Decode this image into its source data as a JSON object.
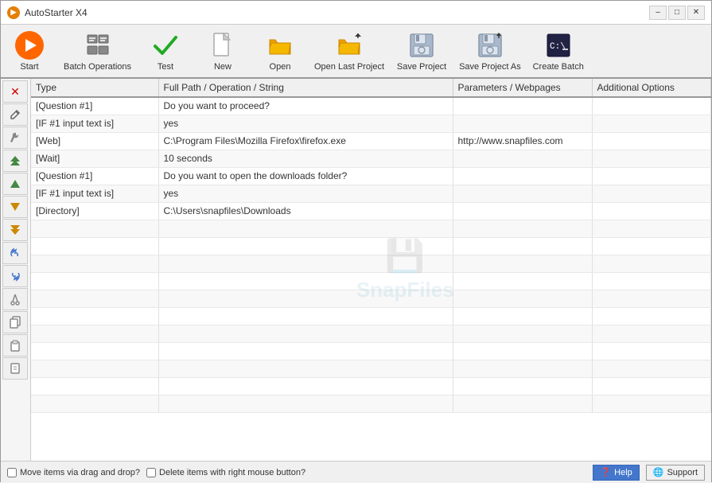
{
  "titleBar": {
    "appName": "AutoStarter X4",
    "minimizeLabel": "–",
    "maximizeLabel": "□",
    "closeLabel": "✕"
  },
  "toolbar": {
    "buttons": [
      {
        "id": "start",
        "label": "Start",
        "iconType": "start"
      },
      {
        "id": "batch-operations",
        "label": "Batch Operations",
        "iconType": "batch"
      },
      {
        "id": "test",
        "label": "Test",
        "iconType": "check"
      },
      {
        "id": "new",
        "label": "New",
        "iconType": "new"
      },
      {
        "id": "open",
        "label": "Open",
        "iconType": "folder"
      },
      {
        "id": "open-last-project",
        "label": "Open Last Project",
        "iconType": "folder-open"
      },
      {
        "id": "save-project",
        "label": "Save Project",
        "iconType": "save"
      },
      {
        "id": "save-project-as",
        "label": "Save Project As",
        "iconType": "save-as"
      },
      {
        "id": "create-batch",
        "label": "Create Batch",
        "iconType": "batch-create"
      }
    ]
  },
  "sideToolbar": {
    "buttons": [
      {
        "id": "delete",
        "icon": "✕",
        "tooltip": "Delete",
        "color": "red"
      },
      {
        "id": "tool2",
        "icon": "🔧",
        "tooltip": "Edit"
      },
      {
        "id": "tool3",
        "icon": "✏️",
        "tooltip": "Rename"
      },
      {
        "id": "move-up-fast",
        "icon": "⬆",
        "tooltip": "Move Up Fast"
      },
      {
        "id": "move-up",
        "icon": "↑",
        "tooltip": "Move Up"
      },
      {
        "id": "move-down",
        "icon": "↓",
        "tooltip": "Move Down"
      },
      {
        "id": "move-down-fast",
        "icon": "⬇",
        "tooltip": "Move Down Fast"
      },
      {
        "id": "rotate-up",
        "icon": "↩",
        "tooltip": "Rotate Up"
      },
      {
        "id": "rotate-down",
        "icon": "↪",
        "tooltip": "Rotate Down"
      },
      {
        "id": "cut",
        "icon": "✂",
        "tooltip": "Cut"
      },
      {
        "id": "copy",
        "icon": "⧉",
        "tooltip": "Copy"
      },
      {
        "id": "paste",
        "icon": "📋",
        "tooltip": "Paste"
      },
      {
        "id": "paste2",
        "icon": "📄",
        "tooltip": "Paste Special"
      }
    ]
  },
  "table": {
    "columns": [
      {
        "id": "type",
        "label": "Type"
      },
      {
        "id": "path",
        "label": "Full Path / Operation / String"
      },
      {
        "id": "params",
        "label": "Parameters / Webpages"
      },
      {
        "id": "options",
        "label": "Additional Options"
      }
    ],
    "rows": [
      {
        "type": "[Question #1]",
        "path": "Do you want to proceed?",
        "params": "",
        "options": ""
      },
      {
        "type": "[IF #1 input text is]",
        "path": "yes",
        "params": "",
        "options": ""
      },
      {
        "type": "[Web]",
        "path": "C:\\Program Files\\Mozilla Firefox\\firefox.exe",
        "params": "http://www.snapfiles.com",
        "options": ""
      },
      {
        "type": "[Wait]",
        "path": "10 seconds",
        "params": "",
        "options": ""
      },
      {
        "type": "[Question #1]",
        "path": "Do you want to open the downloads folder?",
        "params": "",
        "options": ""
      },
      {
        "type": "[IF #1 input text is]",
        "path": "yes",
        "params": "",
        "options": ""
      },
      {
        "type": "[Directory]",
        "path": "C:\\Users\\snapfiles\\Downloads",
        "params": "",
        "options": ""
      },
      {
        "type": "",
        "path": "",
        "params": "",
        "options": ""
      },
      {
        "type": "",
        "path": "",
        "params": "",
        "options": ""
      },
      {
        "type": "",
        "path": "",
        "params": "",
        "options": ""
      },
      {
        "type": "",
        "path": "",
        "params": "",
        "options": ""
      },
      {
        "type": "",
        "path": "",
        "params": "",
        "options": ""
      },
      {
        "type": "",
        "path": "",
        "params": "",
        "options": ""
      },
      {
        "type": "",
        "path": "",
        "params": "",
        "options": ""
      },
      {
        "type": "",
        "path": "",
        "params": "",
        "options": ""
      },
      {
        "type": "",
        "path": "",
        "params": "",
        "options": ""
      },
      {
        "type": "",
        "path": "",
        "params": "",
        "options": ""
      },
      {
        "type": "",
        "path": "",
        "params": "",
        "options": ""
      }
    ]
  },
  "watermark": {
    "text": "SnapFiles"
  },
  "statusBar": {
    "checkbox1Label": "Move items via drag and drop?",
    "checkbox2Label": "Delete items with right mouse button?",
    "helpLabel": "Help",
    "supportLabel": "Support"
  }
}
